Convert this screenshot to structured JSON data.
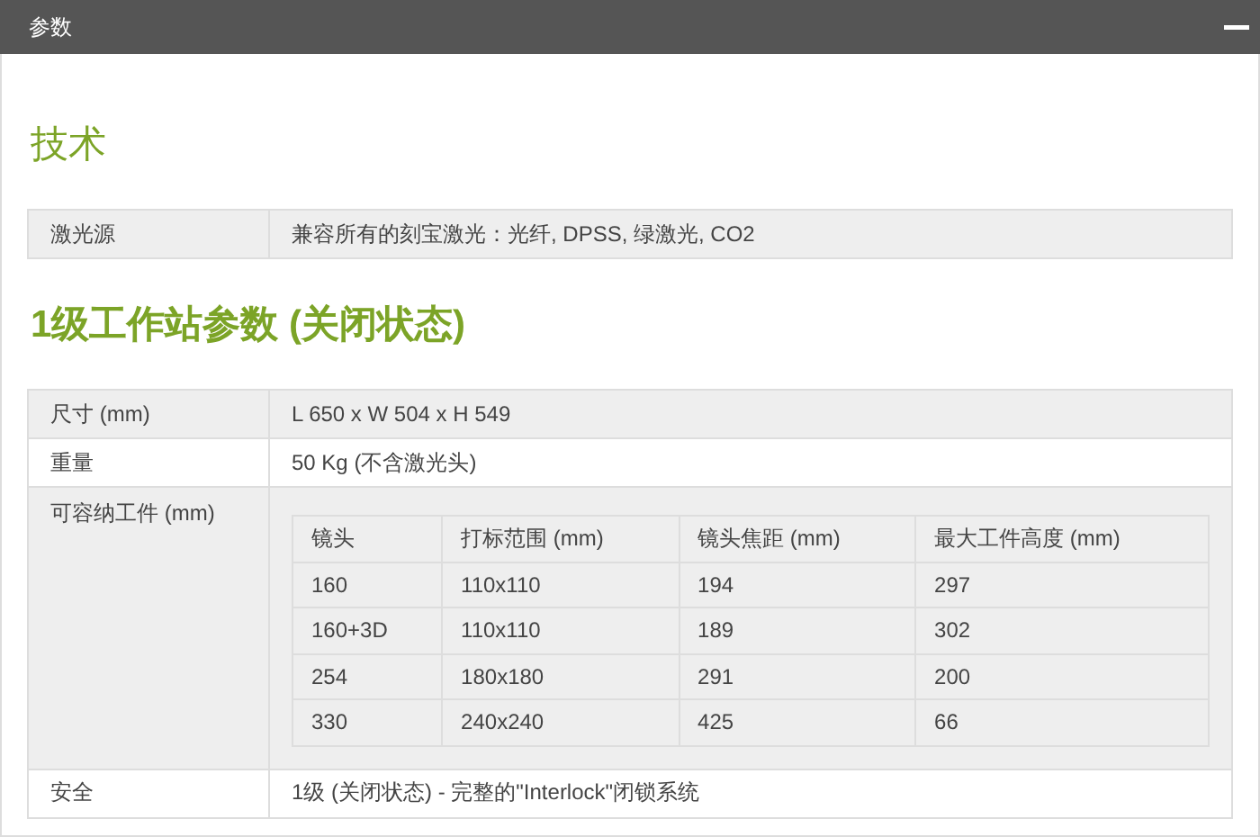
{
  "panel": {
    "title": "参数",
    "expanded": true
  },
  "sections": [
    {
      "heading": "技术",
      "rows": [
        {
          "kind": "text",
          "label": "激光源",
          "value": "兼容所有的刻宝激光：光纤, DPSS, 绿激光, CO2"
        }
      ]
    },
    {
      "heading": "1级工作站参数 (关闭状态)",
      "rows": [
        {
          "kind": "text",
          "label": "尺寸 (mm)",
          "value": "L 650 x W 504 x H 549"
        },
        {
          "kind": "text",
          "label": "重量",
          "value": "50 Kg (不含激光头)"
        },
        {
          "kind": "table",
          "label": "可容纳工件 (mm)",
          "table": {
            "columns": [
              "镜头",
              "打标范围 (mm)",
              "镜头焦距 (mm)",
              "最大工件高度 (mm)"
            ],
            "rows": [
              [
                "160",
                "110x110",
                "194",
                "297"
              ],
              [
                "160+3D",
                "110x110",
                "189",
                "302"
              ],
              [
                "254",
                "180x180",
                "291",
                "200"
              ],
              [
                "330",
                "240x240",
                "425",
                "66"
              ]
            ]
          }
        },
        {
          "kind": "text",
          "label": "安全",
          "value": "1级 (关闭状态) - 完整的\"Interlock\"闭锁系统"
        }
      ]
    }
  ]
}
